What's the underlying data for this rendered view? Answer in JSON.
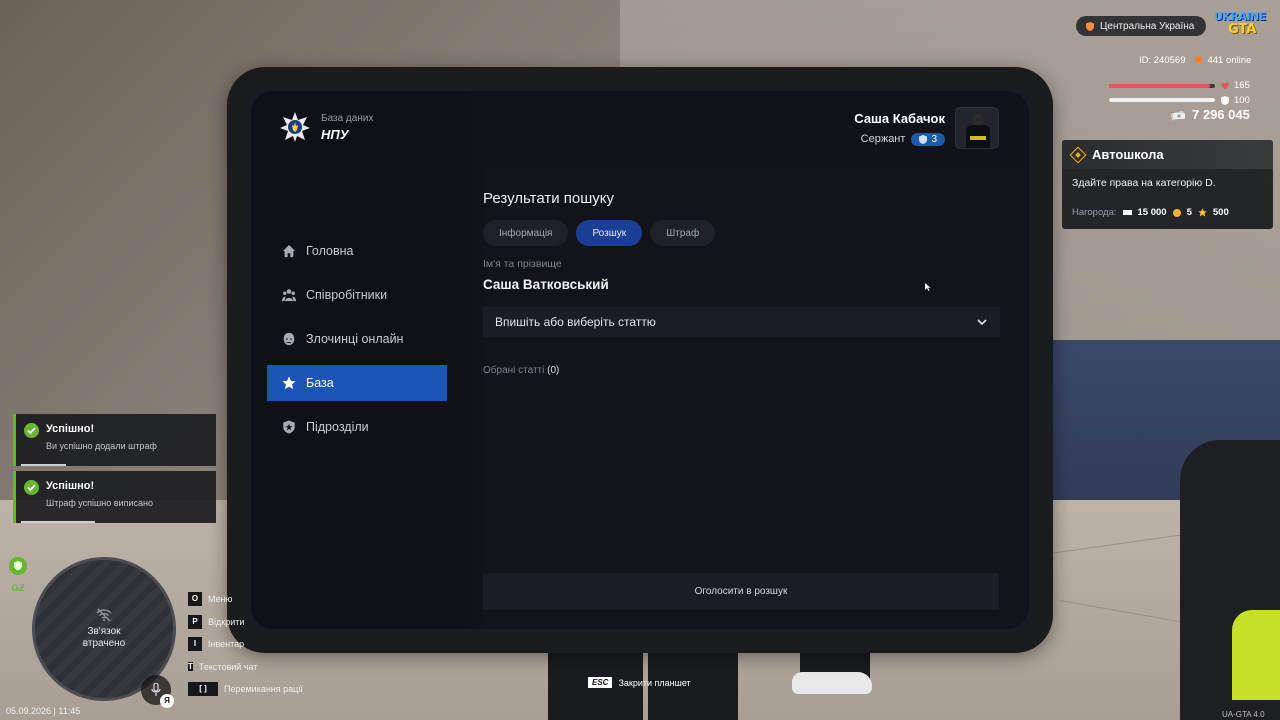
{
  "tablet": {
    "brand": {
      "subtitle": "База даних",
      "title": "НПУ"
    },
    "nav": [
      {
        "label": "Головна",
        "icon": "home-icon",
        "active": false
      },
      {
        "label": "Співробітники",
        "icon": "people-icon",
        "active": false
      },
      {
        "label": "Злочинці онлайн",
        "icon": "criminal-icon",
        "active": false
      },
      {
        "label": "База",
        "icon": "star-icon",
        "active": true
      },
      {
        "label": "Підрозділи",
        "icon": "shield-icon",
        "active": false
      }
    ],
    "user": {
      "name": "Саша Кабачок",
      "rank": "Сержант",
      "rank_level": "3"
    },
    "results": {
      "title": "Результати пошуку",
      "tabs": [
        {
          "label": "Інформація",
          "active": false
        },
        {
          "label": "Розшук",
          "active": true
        },
        {
          "label": "Штраф",
          "active": false
        }
      ],
      "name_label": "Ім'я та прізвище",
      "name_value": "Саша Ватковський",
      "article_select": "Впишіть або виберіть статтю",
      "selected_label": "Обрані статті",
      "selected_count": "(0)",
      "announce_button": "Оголосити в розшук"
    }
  },
  "hud": {
    "region": "Центральна Україна",
    "logo_top": "UKRAINE",
    "logo_bottom": "GTA",
    "player_id": "ID: 240569",
    "online": "441 online",
    "health": {
      "value": "165",
      "fraction": 0.95
    },
    "armor": {
      "value": "100",
      "fraction": 1.0
    },
    "money": "7 296 045",
    "quest": {
      "title": "Автошкола",
      "text": "Здайте права на категорію D.",
      "reward_label": "Нагорода:",
      "reward_money": "15 000",
      "reward_coins": "5",
      "reward_stars": "500"
    },
    "notifications": [
      {
        "title": "Успішно!",
        "text": "Ви успішно додали штраф",
        "progress": 0.23
      },
      {
        "title": "Успішно!",
        "text": "Штраф успішно виписано",
        "progress": 0.38
      }
    ],
    "zone": "GZ",
    "minimap_status": "Зв'язок\nвтрачено",
    "mic_key": "Я",
    "controls": [
      {
        "key": "O",
        "label": "Меню"
      },
      {
        "key": "P",
        "label": "Відкрити"
      },
      {
        "key": "I",
        "label": "Інвентар"
      },
      {
        "key": "T",
        "label": "Текстовий чат"
      },
      {
        "key": "[ ]",
        "label": "Перемикання рації"
      }
    ],
    "datetime": "05.09.2026 | 11:45",
    "esc_key": "ESC",
    "esc_hint": "Закрити планшет",
    "version": "UA-GTA 4.0",
    "colors": {
      "accent": "#1b56b6",
      "success": "#68b532",
      "health": "#e25866",
      "quest": "#ffb400"
    }
  }
}
